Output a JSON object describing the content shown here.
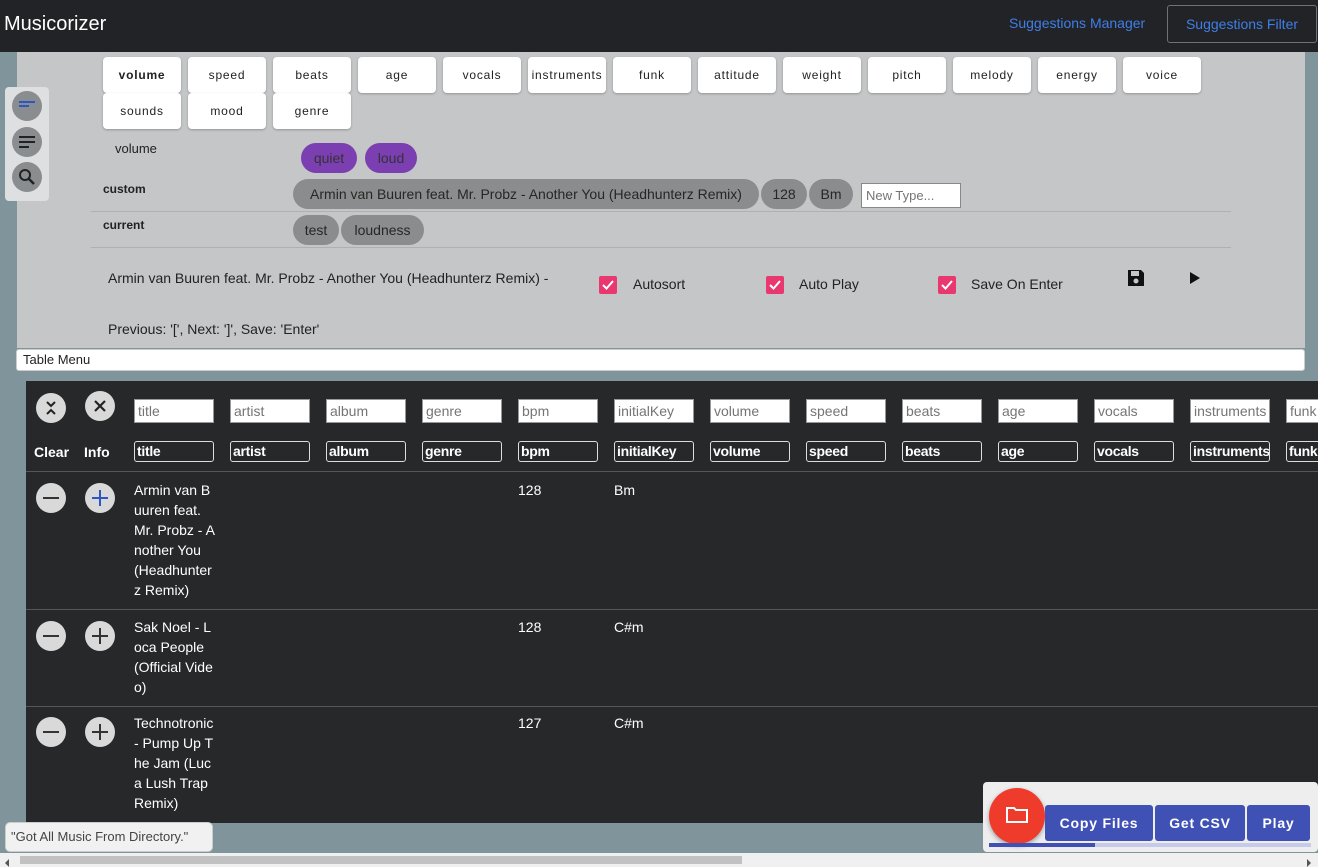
{
  "app": {
    "title": "Musicorizer"
  },
  "header": {
    "suggestions_manager": "Suggestions Manager",
    "suggestions_filter": "Suggestions Filter"
  },
  "tag_tabs": [
    "volume",
    "speed",
    "beats",
    "age",
    "vocals",
    "instruments",
    "funk",
    "attitude",
    "weight",
    "pitch",
    "melody",
    "energy",
    "voice",
    "sounds",
    "mood",
    "genre"
  ],
  "active_tab": "volume",
  "tag_editor": {
    "category_label": "volume",
    "category_options": [
      "quiet",
      "loud"
    ],
    "custom_label": "custom",
    "custom_tags": [
      "Armin van Buuren feat. Mr. Probz - Another You (Headhunterz Remix)",
      "128",
      "Bm"
    ],
    "new_type_placeholder": "New Type...",
    "current_label": "current",
    "current_tags": [
      "test",
      "loudness"
    ]
  },
  "now_playing": "Armin van Buuren feat. Mr. Probz - Another You (Headhunterz Remix) -",
  "options": {
    "autosort": "Autosort",
    "auto_play": "Auto Play",
    "save_on_enter": "Save On Enter"
  },
  "shortcuts": "Previous: '[', Next: ']', Save: 'Enter'",
  "table_menu": "Table Menu",
  "table": {
    "clear_label": "Clear",
    "info_label": "Info",
    "columns": [
      "title",
      "artist",
      "album",
      "genre",
      "bpm",
      "initialKey",
      "volume",
      "speed",
      "beats",
      "age",
      "vocals",
      "instruments",
      "funk"
    ],
    "rows": [
      {
        "title": "Armin van Buuren feat. Mr. Probz - Another You (Headhunterz Remix)",
        "bpm": "128",
        "key": "Bm"
      },
      {
        "title": "Sak Noel - Loca People (Official Video)",
        "bpm": "128",
        "key": "C#m"
      },
      {
        "title": "Technotronic - Pump Up The Jam (Luca Lush Trap Remix)",
        "bpm": "127",
        "key": "C#m"
      }
    ]
  },
  "status_note": "\"Got All Music From Directory.\"",
  "actions": {
    "copy_files": "Copy Files",
    "get_csv": "Get CSV",
    "play": "Play"
  },
  "progress": 0.33,
  "colors": {
    "accent_blue": "#3f51b5",
    "fab_red": "#ef3b2c",
    "checkbox_pink": "#e8386f",
    "chip_purple": "#7c3fb1",
    "link_blue": "#3f7ee8"
  }
}
